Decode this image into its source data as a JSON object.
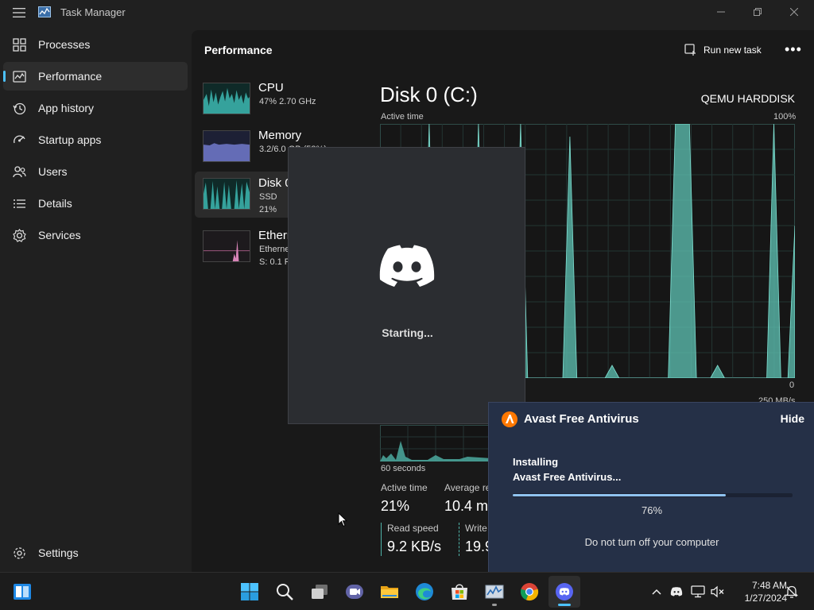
{
  "window": {
    "title": "Task Manager",
    "controls": [
      "minimize",
      "maximize",
      "close"
    ]
  },
  "sidebar": {
    "items": [
      {
        "label": "Processes",
        "icon": "grid-icon"
      },
      {
        "label": "Performance",
        "icon": "performance-icon",
        "active": true
      },
      {
        "label": "App history",
        "icon": "history-icon"
      },
      {
        "label": "Startup apps",
        "icon": "startup-icon"
      },
      {
        "label": "Users",
        "icon": "users-icon"
      },
      {
        "label": "Details",
        "icon": "list-icon"
      },
      {
        "label": "Services",
        "icon": "puzzle-icon"
      }
    ],
    "settings_label": "Settings"
  },
  "header": {
    "title": "Performance",
    "run_new_task": "Run new task",
    "more": "•••"
  },
  "resources": [
    {
      "name": "CPU",
      "line1": "47%  2.70 GHz",
      "line2": ""
    },
    {
      "name": "Memory",
      "line1": "3.2/6.0 GB (53%)",
      "line2": ""
    },
    {
      "name": "Disk 0 (C:)",
      "line1": "SSD",
      "line2": "21%"
    },
    {
      "name": "Ethernet",
      "line1": "Ethernet",
      "line2": "S: 0.1 R: 0 Kbps"
    }
  ],
  "detail": {
    "title": "Disk 0 (C:)",
    "model": "QEMU HARDDISK",
    "active_time_label": "Active time",
    "active_max": "100%",
    "active_min": "0",
    "transfer_max": "250 MB/s",
    "sixty_seconds": "60 seconds",
    "stats": {
      "active_time_label": "Active time",
      "active_time_value": "21%",
      "avg_response_label": "Average response time",
      "avg_response_value": "10.4 ms",
      "read_speed_label": "Read speed",
      "read_speed_value": "9.2 KB/s",
      "write_speed_label": "Write speed",
      "write_speed_value": "19.9 KB/s"
    }
  },
  "chart_data": {
    "type": "area",
    "title": "Active time",
    "ylim": [
      0,
      100
    ],
    "x_points": 60,
    "values": [
      0,
      0,
      0,
      0,
      0,
      0,
      0,
      100,
      0,
      0,
      0,
      0,
      0,
      0,
      100,
      0,
      0,
      5,
      0,
      0,
      100,
      0,
      0,
      0,
      0,
      0,
      0,
      95,
      0,
      0,
      0,
      0,
      0,
      5,
      0,
      0,
      0,
      0,
      0,
      0,
      0,
      0,
      100,
      100,
      100,
      0,
      0,
      0,
      5,
      0,
      0,
      0,
      0,
      0,
      0,
      0,
      100,
      0,
      0,
      60
    ]
  },
  "discord": {
    "status": "Starting..."
  },
  "avast": {
    "title": "Avast Free Antivirus",
    "hide_label": "Hide",
    "installing_line1": "Installing",
    "installing_line2": "Avast Free Antivirus...",
    "progress": 0.76,
    "percent_label": "76%",
    "warning": "Do not turn off your computer"
  },
  "taskbar": {
    "apps": [
      "start-icon",
      "search-icon",
      "task-view-icon",
      "teams-icon",
      "file-explorer-icon",
      "edge-icon",
      "store-icon",
      "task-manager-icon",
      "chrome-icon",
      "discord-icon"
    ],
    "clock_time": "7:48 AM",
    "clock_date": "1/27/2024"
  },
  "colors": {
    "accent": "#4cc2ff",
    "disk_chart": "#5fc4b5",
    "avast_bg": "#253047",
    "discord_bg": "#2b2d31"
  }
}
